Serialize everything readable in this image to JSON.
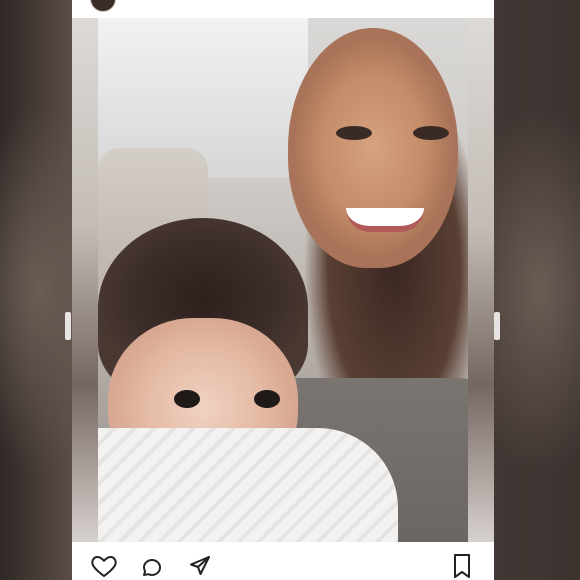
{
  "post": {
    "image": {
      "alt": ""
    },
    "actions": {
      "like_icon": "heart-icon",
      "comment_icon": "comment-icon",
      "share_icon": "share-icon",
      "save_icon": "bookmark-icon"
    }
  }
}
